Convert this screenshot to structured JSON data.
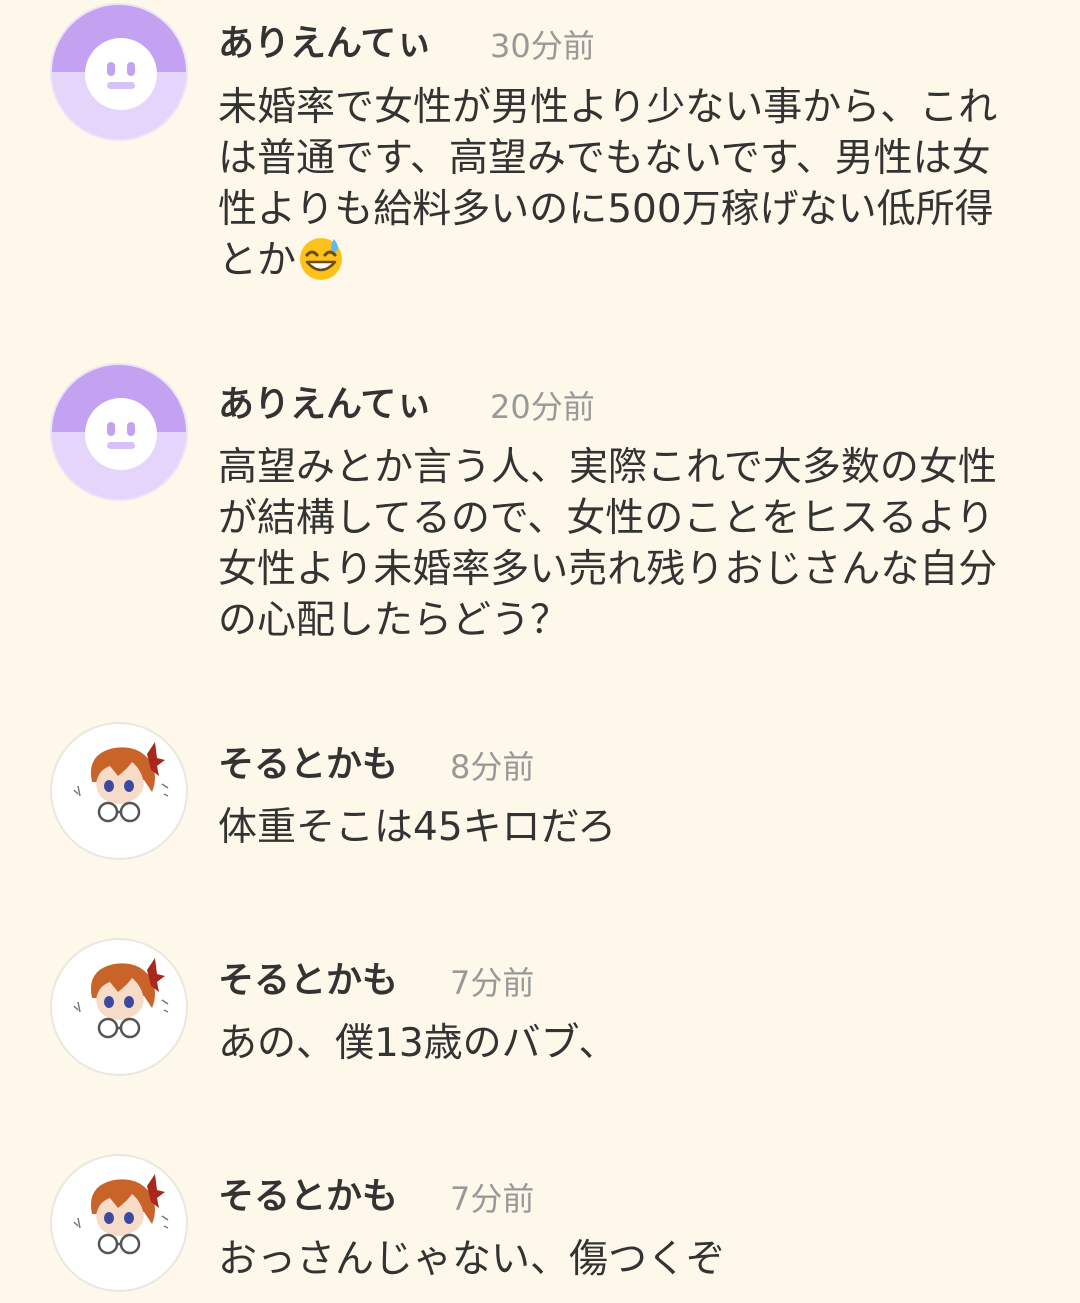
{
  "comments": [
    {
      "author": "ありえんてぃ",
      "time": "30分前",
      "text": "未婚率で女性が男性より少ない事から、これは普通です、高望みでもないです、男性は女性よりも給料多いのに500万稼げない低所得とか",
      "emoji": "grinning-sweat-emoji",
      "avatar": "default-avatar-icon"
    },
    {
      "author": "ありえんてぃ",
      "time": "20分前",
      "text": "高望みとか言う人、実際これで大多数の女性が結構してるので、女性のことをヒスるより女性より未婚率多い売れ残りおじさんな自分の心配したらどう？",
      "avatar": "default-avatar-icon"
    },
    {
      "author": "そるとかも",
      "time": "8分前",
      "text": "体重そこは45キロだろ",
      "avatar": "character-avatar-icon"
    },
    {
      "author": "そるとかも",
      "time": "7分前",
      "text": "あの、僕13歳のバブ、",
      "avatar": "character-avatar-icon"
    },
    {
      "author": "そるとかも",
      "time": "7分前",
      "text": "おっさんじゃない、傷つくぞ",
      "avatar": "character-avatar-icon"
    }
  ],
  "colors": {
    "background": "#fdf8ea",
    "text": "#333333",
    "time": "#999999",
    "avatar_purple": "#c3a2f2",
    "avatar_purple_light": "#e6d5fb"
  }
}
